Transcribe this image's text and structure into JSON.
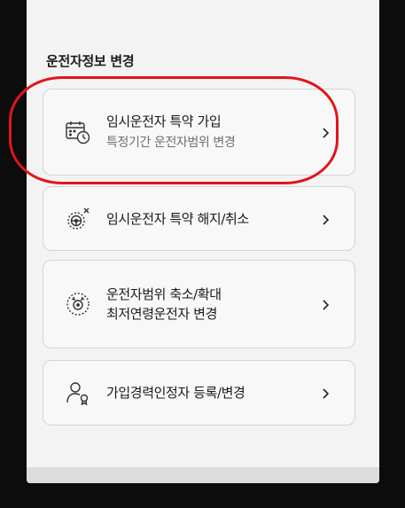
{
  "section": {
    "title": "운전자정보 변경"
  },
  "menu": [
    {
      "icon": "calendar-clock-icon",
      "title": "임시운전자 특약 가입",
      "subtitle": "특정기간 운전자범위 변경"
    },
    {
      "icon": "steering-wheel-cancel-icon",
      "title": "임시운전자 특약 해지/취소"
    },
    {
      "icon": "driver-range-icon",
      "title_line1": "운전자범위 축소/확대",
      "title_line2": "최저연령운전자 변경"
    },
    {
      "icon": "person-certificate-icon",
      "title": "가입경력인정자 등록/변경"
    }
  ],
  "colors": {
    "highlight": "#e3141b",
    "background": "#f3f3f3"
  }
}
